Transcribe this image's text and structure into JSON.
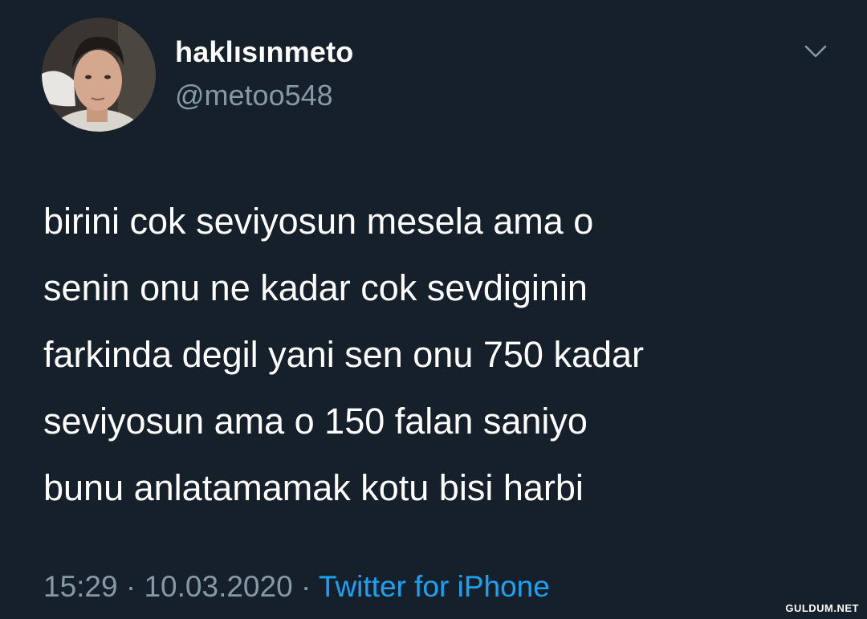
{
  "tweet": {
    "display_name": "haklısınmeto",
    "handle": "@metoo548",
    "text_lines": [
      "birini cok seviyosun mesela ama o",
      "senin onu ne kadar cok sevdiginin",
      "farkinda degil yani sen onu 750 kadar",
      "seviyosun ama o 150 falan saniyo",
      "bunu anlatamamak kotu bisi harbi"
    ],
    "time": "15:29",
    "separator": "·",
    "date": "10.03.2020",
    "source": "Twitter for iPhone",
    "more_icon": "chevron-down-icon",
    "avatar_icon": "avatar"
  },
  "watermark": "GULDUM.NET",
  "colors": {
    "background": "#15202b",
    "primary_text": "#ffffff",
    "secondary_text": "#8899a6",
    "link": "#1da1f2"
  }
}
